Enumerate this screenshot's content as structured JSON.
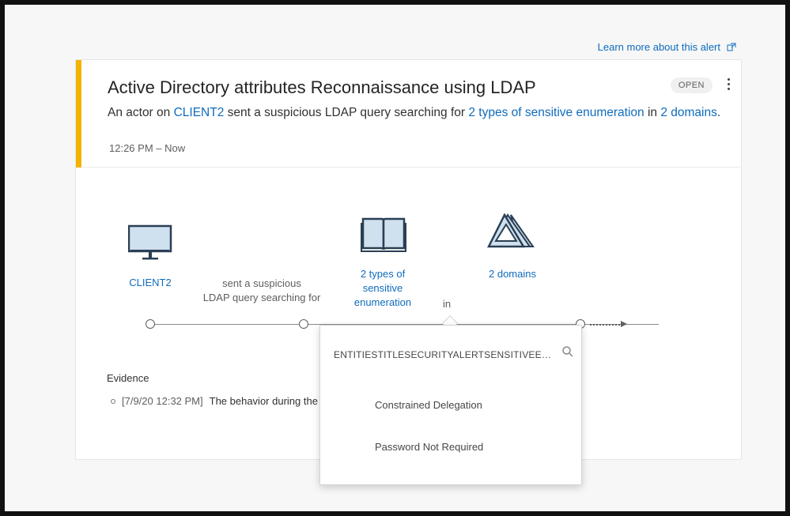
{
  "learn_more": {
    "label": "Learn more about this alert"
  },
  "alert": {
    "title": "Active Directory attributes Reconnaissance using LDAP",
    "status": "OPEN",
    "description": {
      "prefix": "An actor on ",
      "client": "CLIENT2",
      "middle": " sent a suspicious LDAP query searching for ",
      "types": "2 types of sensitive enumeration",
      "in": " in ",
      "domains": "2 domains",
      "end": "."
    },
    "time": "12:26 PM – Now"
  },
  "graph": {
    "client_label": "CLIENT2",
    "action_label_line1": "sent a suspicious",
    "action_label_line2": "LDAP query searching for",
    "types_line1": "2 types of",
    "types_line2": "sensitive",
    "types_line3": "enumeration",
    "in_label": "in",
    "domains_label": "2 domains"
  },
  "evidence": {
    "heading": "Evidence",
    "item_date": "[7/9/20 12:32 PM]",
    "item_text": "The behavior during the"
  },
  "popup": {
    "search_label": "ENTITIESTITLESECURITYALERTSENSITIVEENUMERATION",
    "items": [
      "Constrained Delegation",
      "Password Not Required"
    ]
  },
  "icons": {
    "external": "external-link-icon",
    "monitor": "monitor-icon",
    "book": "book-icon",
    "domains": "domains-icon",
    "search": "search-icon",
    "more": "more-vertical-icon"
  },
  "colors": {
    "accent": "#f2b400",
    "link": "#0f6cbd"
  }
}
